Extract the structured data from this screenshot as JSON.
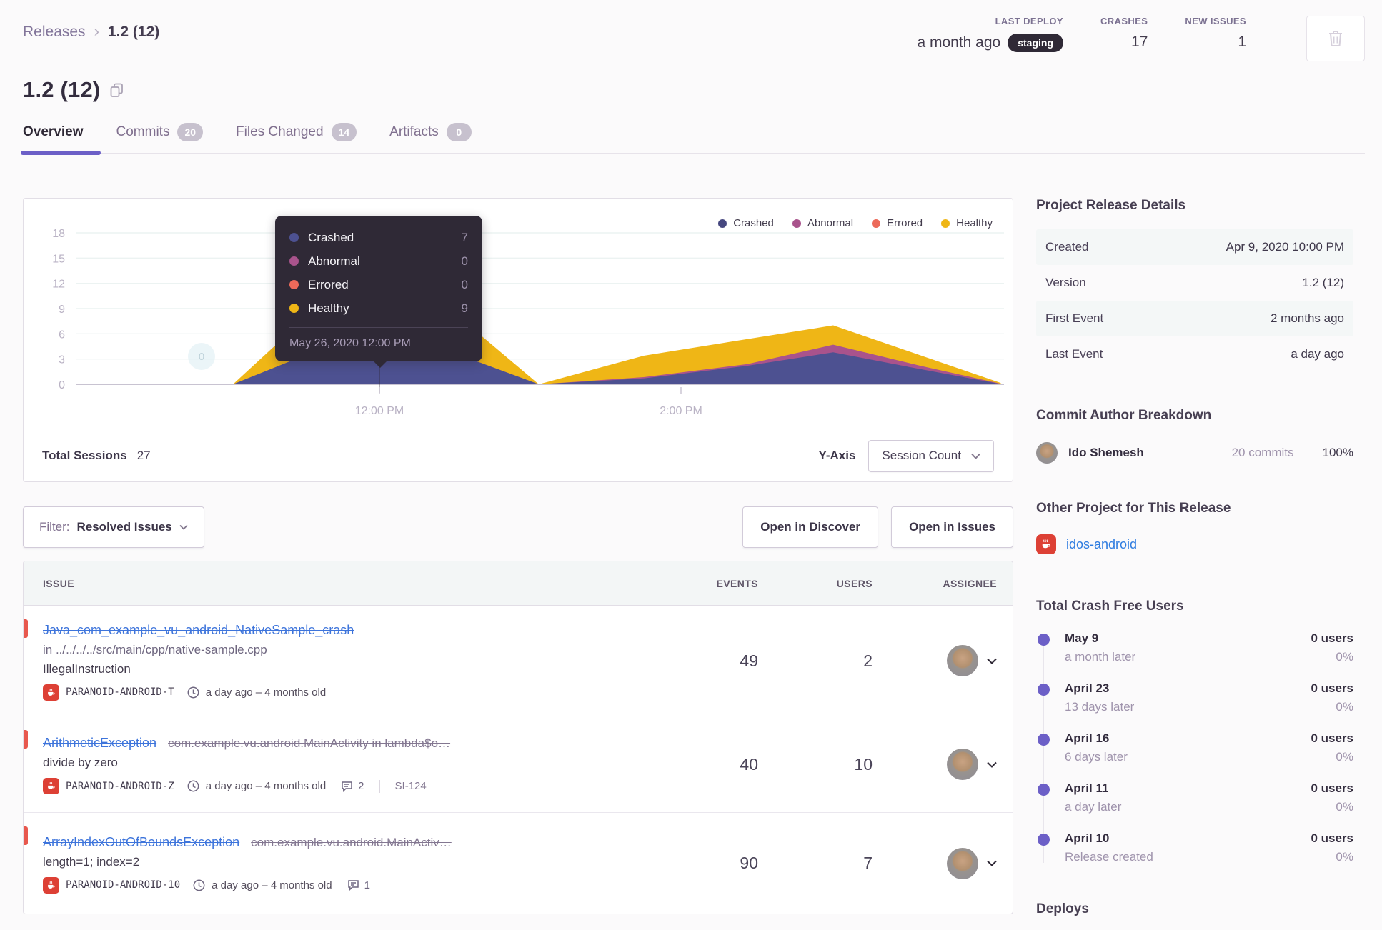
{
  "breadcrumb": {
    "root": "Releases",
    "current": "1.2 (12)"
  },
  "headerStats": {
    "lastDeploy": {
      "label": "LAST DEPLOY",
      "value": "a month ago",
      "env": "staging"
    },
    "crashes": {
      "label": "CRASHES",
      "value": "17"
    },
    "newIssues": {
      "label": "NEW ISSUES",
      "value": "1"
    }
  },
  "release": {
    "title": "1.2 (12)"
  },
  "tabs": [
    {
      "label": "Overview",
      "badge": ""
    },
    {
      "label": "Commits",
      "badge": "20"
    },
    {
      "label": "Files Changed",
      "badge": "14"
    },
    {
      "label": "Artifacts",
      "badge": "0"
    }
  ],
  "chart": {
    "legend": [
      {
        "label": "Crashed",
        "color": "#46477f"
      },
      {
        "label": "Abnormal",
        "color": "#a9538c"
      },
      {
        "label": "Errored",
        "color": "#ec6a5a"
      },
      {
        "label": "Healthy",
        "color": "#efb616"
      }
    ],
    "tooltip": {
      "rows": [
        {
          "label": "Crashed",
          "value": "7",
          "color": "#4d5191"
        },
        {
          "label": "Abnormal",
          "value": "0",
          "color": "#a9538c"
        },
        {
          "label": "Errored",
          "value": "0",
          "color": "#ec6a5a"
        },
        {
          "label": "Healthy",
          "value": "9",
          "color": "#efb616"
        }
      ],
      "date": "May 26, 2020 12:00 PM"
    },
    "marker": "0",
    "footer": {
      "totalLabel": "Total Sessions",
      "totalValue": "27",
      "yAxisLabel": "Y-Axis",
      "yAxisValue": "Session Count"
    }
  },
  "chart_data": {
    "type": "area",
    "stacked": true,
    "title": "Sessions by status over time",
    "ylim": [
      0,
      18
    ],
    "y_ticks": [
      18,
      15,
      12,
      9,
      6,
      3,
      0
    ],
    "x_ticks": [
      {
        "label": "12:00 PM",
        "x": 498
      },
      {
        "label": "2:00 PM",
        "x": 920
      }
    ],
    "total_sessions": 27,
    "hover_bucket": {
      "time": "May 26, 2020 12:00 PM",
      "Crashed": 7,
      "Abnormal": 0,
      "Errored": 0,
      "Healthy": 9
    },
    "note": "series are cumulative stack tops in sessions; x in plot px (80-1370)",
    "series": [
      {
        "name": "Healthy stack top (total)",
        "color": "#efb616",
        "points": [
          [
            80,
            0
          ],
          [
            293,
            0
          ],
          [
            498,
            16
          ],
          [
            721,
            0
          ],
          [
            868,
            3.4
          ],
          [
            1133,
            7
          ],
          [
            1366,
            0.2
          ],
          [
            1370,
            0
          ]
        ]
      },
      {
        "name": "Abnormal stack top",
        "color": "#a9538c",
        "points": [
          [
            80,
            0
          ],
          [
            293,
            0
          ],
          [
            498,
            7
          ],
          [
            721,
            0
          ],
          [
            868,
            0.85
          ],
          [
            1013,
            2.4
          ],
          [
            1133,
            4.7
          ],
          [
            1255,
            2.2
          ],
          [
            1366,
            0.1
          ],
          [
            1370,
            0
          ]
        ]
      },
      {
        "name": "Crashed stack top",
        "color": "#4d5191",
        "points": [
          [
            80,
            0
          ],
          [
            293,
            0
          ],
          [
            498,
            7
          ],
          [
            721,
            0
          ],
          [
            868,
            0.7
          ],
          [
            1013,
            2.2
          ],
          [
            1133,
            3.8
          ],
          [
            1255,
            1.8
          ],
          [
            1366,
            0.05
          ],
          [
            1370,
            0
          ]
        ]
      }
    ]
  },
  "controls": {
    "filterLabel": "Filter:",
    "filterValue": "Resolved Issues",
    "discoverBtn": "Open in Discover",
    "issuesBtn": "Open in Issues"
  },
  "issuesTable": {
    "columns": {
      "issue": "ISSUE",
      "events": "EVENTS",
      "users": "USERS",
      "assignee": "ASSIGNEE"
    },
    "rows": [
      {
        "title": "Java_com_example_vu_android_NativeSample_crash",
        "culprit": "in ../../../../src/main/cpp/native-sample.cpp",
        "message": "IllegalInstruction",
        "project": "PARANOID-ANDROID-T",
        "age": "a day ago – 4 months old",
        "events": "49",
        "users": "2"
      },
      {
        "title": "ArithmeticException",
        "titleSuffix": "com.example.vu.android.MainActivity in lambda$o…",
        "message": "divide by zero",
        "project": "PARANOID-ANDROID-Z",
        "age": "a day ago – 4 months old",
        "comments": "2",
        "shortId": "SI-124",
        "events": "40",
        "users": "10"
      },
      {
        "title": "ArrayIndexOutOfBoundsException",
        "titleSuffix": "com.example.vu.android.MainActiv…",
        "message": "length=1; index=2",
        "project": "PARANOID-ANDROID-10",
        "age": "a day ago – 4 months old",
        "comments": "1",
        "events": "90",
        "users": "7"
      }
    ]
  },
  "sidebar": {
    "detailsTitle": "Project Release Details",
    "details": [
      {
        "label": "Created",
        "value": "Apr 9, 2020 10:00 PM"
      },
      {
        "label": "Version",
        "value": "1.2 (12)"
      },
      {
        "label": "First Event",
        "value": "2 months ago"
      },
      {
        "label": "Last Event",
        "value": "a day ago"
      }
    ],
    "commitTitle": "Commit Author Breakdown",
    "author": {
      "name": "Ido Shemesh",
      "commits": "20 commits",
      "percent": "100%"
    },
    "otherTitle": "Other Project for This Release",
    "otherProject": "idos-android",
    "crashFreeTitle": "Total Crash Free Users",
    "timeline": [
      {
        "date": "May 9",
        "sub": "a month later",
        "users": "0 users",
        "pct": "0%"
      },
      {
        "date": "April 23",
        "sub": "13 days later",
        "users": "0 users",
        "pct": "0%"
      },
      {
        "date": "April 16",
        "sub": "6 days later",
        "users": "0 users",
        "pct": "0%"
      },
      {
        "date": "April 11",
        "sub": "a day later",
        "users": "0 users",
        "pct": "0%"
      },
      {
        "date": "April 10",
        "sub": "Release created",
        "users": "0 users",
        "pct": "0%"
      }
    ],
    "deploysTitle": "Deploys"
  }
}
